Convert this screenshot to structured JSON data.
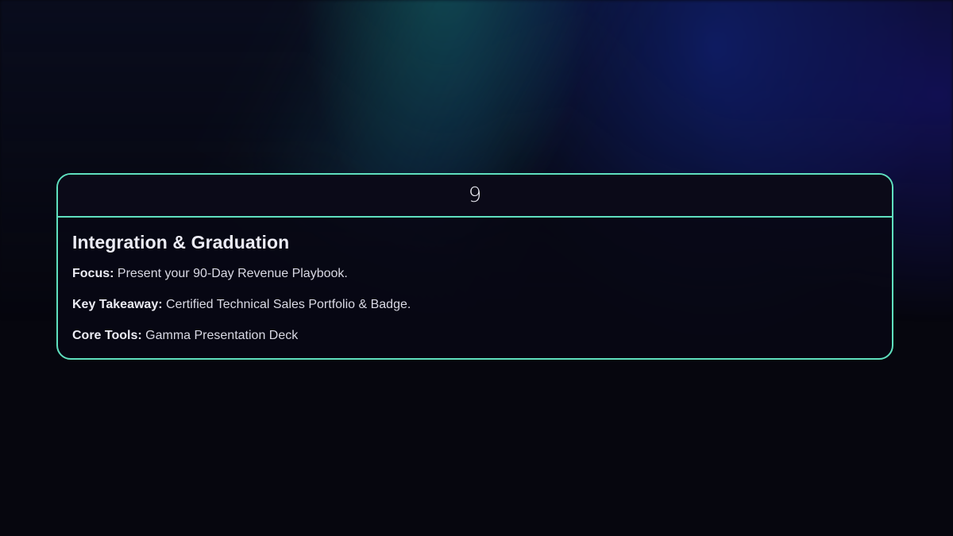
{
  "card": {
    "step_number": "9",
    "title": "Integration & Graduation",
    "lines": [
      {
        "label": "Focus:",
        "value": "Present your 90-Day Revenue Playbook."
      },
      {
        "label": "Key Takeaway:",
        "value": "Certified Technical Sales Portfolio & Badge."
      },
      {
        "label": "Core Tools:",
        "value": "Gamma Presentation Deck"
      }
    ]
  },
  "colors": {
    "accent_border": "#5fe0bf",
    "background": "#06060e"
  }
}
